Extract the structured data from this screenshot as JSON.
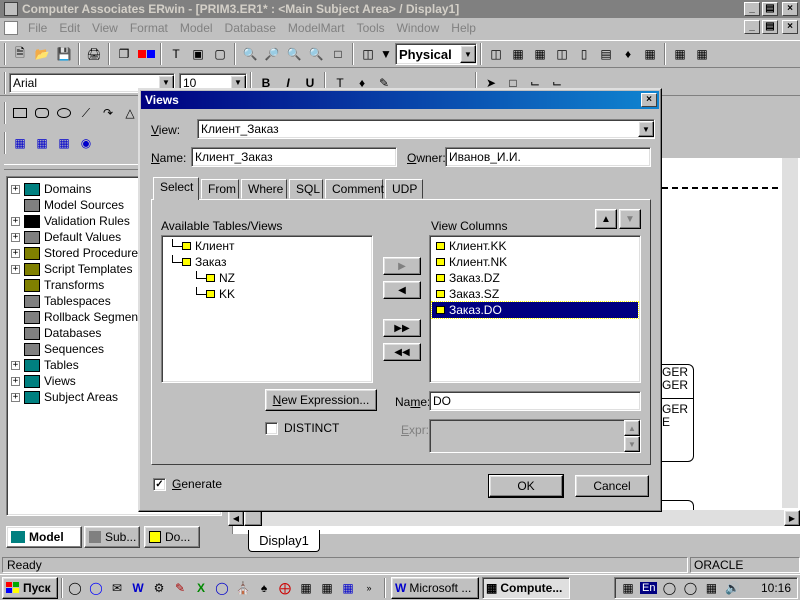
{
  "app": {
    "title": "Computer Associates ERwin - [PRIM3.ER1* : <Main Subject Area> / Display1]",
    "menu": [
      "File",
      "Edit",
      "View",
      "Format",
      "Model",
      "Database",
      "ModelMart",
      "Tools",
      "Window",
      "Help"
    ],
    "window_buttons": [
      "_",
      "»",
      "×"
    ]
  },
  "toolbar": {
    "physical_select": "Physical",
    "font_name": "Arial",
    "font_size": "10",
    "bold": "B",
    "italic": "I",
    "underline": "U"
  },
  "tree": {
    "items": [
      {
        "label": "Domains",
        "expand": "+"
      },
      {
        "label": "Model Sources",
        "expand": ""
      },
      {
        "label": "Validation Rules",
        "expand": "+"
      },
      {
        "label": "Default Values",
        "expand": "+"
      },
      {
        "label": "Stored Procedures",
        "expand": "+"
      },
      {
        "label": "Script Templates",
        "expand": "+"
      },
      {
        "label": "Transforms",
        "expand": ""
      },
      {
        "label": "Tablespaces",
        "expand": ""
      },
      {
        "label": "Rollback Segments",
        "expand": ""
      },
      {
        "label": "Databases",
        "expand": ""
      },
      {
        "label": "Sequences",
        "expand": ""
      },
      {
        "label": "Tables",
        "expand": "+"
      },
      {
        "label": "Views",
        "expand": "+"
      },
      {
        "label": "Subject Areas",
        "expand": "+"
      }
    ],
    "bottom_tabs": [
      "Model",
      "Sub...",
      "Do..."
    ]
  },
  "canvas": {
    "entity_text": [
      "GER",
      "GER",
      "GER",
      "E"
    ],
    "display_tab": "Display1"
  },
  "dialog": {
    "title": "Views",
    "view_label": "View:",
    "view_value": "Клиент_Заказ",
    "name_label": "Name:",
    "name_value": "Клиент_Заказ",
    "owner_label": "Owner:",
    "owner_value": "Иванов_И.И.",
    "tabs": [
      "Select",
      "From",
      "Where",
      "SQL",
      "Comment",
      "UDP"
    ],
    "available_label": "Available Tables/Views",
    "available_tree": [
      {
        "label": "Клиент",
        "level": 0
      },
      {
        "label": "Заказ",
        "level": 0
      },
      {
        "label": "NZ",
        "level": 1
      },
      {
        "label": "KK",
        "level": 1
      }
    ],
    "view_columns_label": "View Columns",
    "view_columns": [
      {
        "label": "Клиент.KK",
        "selected": false
      },
      {
        "label": "Клиент.NK",
        "selected": false
      },
      {
        "label": "Заказ.DZ",
        "selected": false
      },
      {
        "label": "Заказ.SZ",
        "selected": false
      },
      {
        "label": "Заказ.DO",
        "selected": true
      }
    ],
    "new_expression_button": "New Expression...",
    "distinct_label": "DISTINCT",
    "column_name_label": "Name:",
    "column_name_value": "DO",
    "expr_label": "Expr:",
    "generate_label": "Generate",
    "generate_checked": true,
    "ok_button": "OK",
    "cancel_button": "Cancel"
  },
  "status": {
    "ready": "Ready",
    "db": "ORACLE"
  },
  "taskbar": {
    "start": "Пуск",
    "tasks": [
      "Microsoft ...",
      "Compute..."
    ],
    "lang": "En",
    "time": "10:16"
  },
  "colors": {
    "titlebar": "#000080",
    "face": "#c0c0c0",
    "selection": "#000080"
  }
}
